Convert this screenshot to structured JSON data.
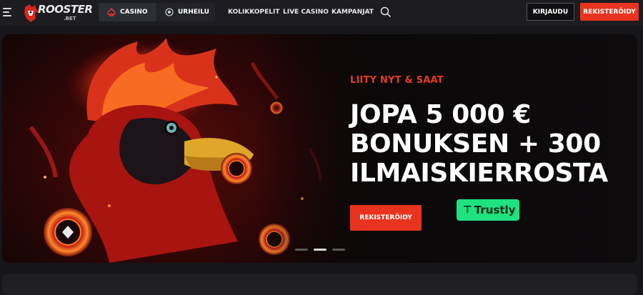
{
  "header": {
    "logo_text": "ROOSTER",
    "logo_sub": ".BET",
    "tabs": [
      {
        "label": "CASINO",
        "icon": "spade-icon",
        "active": true
      },
      {
        "label": "URHEILU",
        "icon": "soccer-ball-icon",
        "active": false
      }
    ],
    "nav": [
      "KOLIKKOPELIT",
      "LIVE CASINO",
      "KAMPANJAT"
    ],
    "search_icon": "search-icon",
    "login_label": "KIRJAUDU",
    "register_label": "REKISTERÖIDY",
    "accent_color": "#e8341f"
  },
  "banner": {
    "eyebrow": "LIITY NYT & SAAT",
    "headline": [
      "JOPA 5 000 €",
      "BONUKSEN + 300",
      "ILMAISKIERROSTA"
    ],
    "cta_label": "REKISTERÖIDY",
    "payment_badge": "Trustly",
    "slides_total": 3,
    "active_slide": 2
  }
}
